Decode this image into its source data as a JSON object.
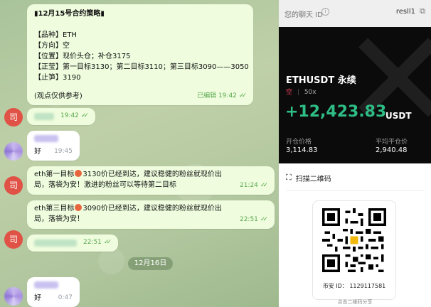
{
  "chat": {
    "strategy": {
      "title": "▮12月15号合约策略▮",
      "lines": [
        "【品种】ETH",
        "【方向】空",
        "【位置】现价头仓；补仓3175",
        "【正莹】第一目标3130；第二目标3110；第三目标3090——3050",
        "【止笋】3190"
      ],
      "note": "(观点仅供参考)",
      "edited_time": "已编辑 19:42"
    },
    "msg_time_1942": "19:42",
    "reply_good_1": {
      "text": "好",
      "time": "19:45"
    },
    "target1": {
      "text_pre": "eth第一目标",
      "text_post": "3130价已经到达，建议稳健的粉丝就现价出局，落袋为安！激进的粉丝可以等待第二目标",
      "time": "21:24"
    },
    "target3": {
      "text_pre": "eth第三目标",
      "text_post": "3090价已经到达，建议稳健的粉丝就现价出局，落袋为安！",
      "time": "22:51"
    },
    "msg_time_2251": "22:51",
    "date_divider": "12月16日",
    "reply_good_2": {
      "text": "好",
      "time": "0:47"
    },
    "avatar_char": "司"
  },
  "panel": {
    "header_left": "您的聊天 ID",
    "header_right": "resll1",
    "pair": "ETHUSDT 永续",
    "side": "空",
    "leverage": "50x",
    "pnl": "+12,423.83",
    "pnl_unit": "USDT",
    "open_label": "开仓价格",
    "open_value": "3,114.83",
    "close_label": "平均平仓价",
    "close_value": "2,940.48",
    "scan_label": "扫描二维码",
    "user_id_label": "币安 ID：",
    "user_id": "1129117581",
    "share_text": "点击二维码分享"
  },
  "colors": {
    "profit": "#2ebd85",
    "short": "#f6465d",
    "bubble": "#effdde",
    "check": "#5aa84f"
  }
}
